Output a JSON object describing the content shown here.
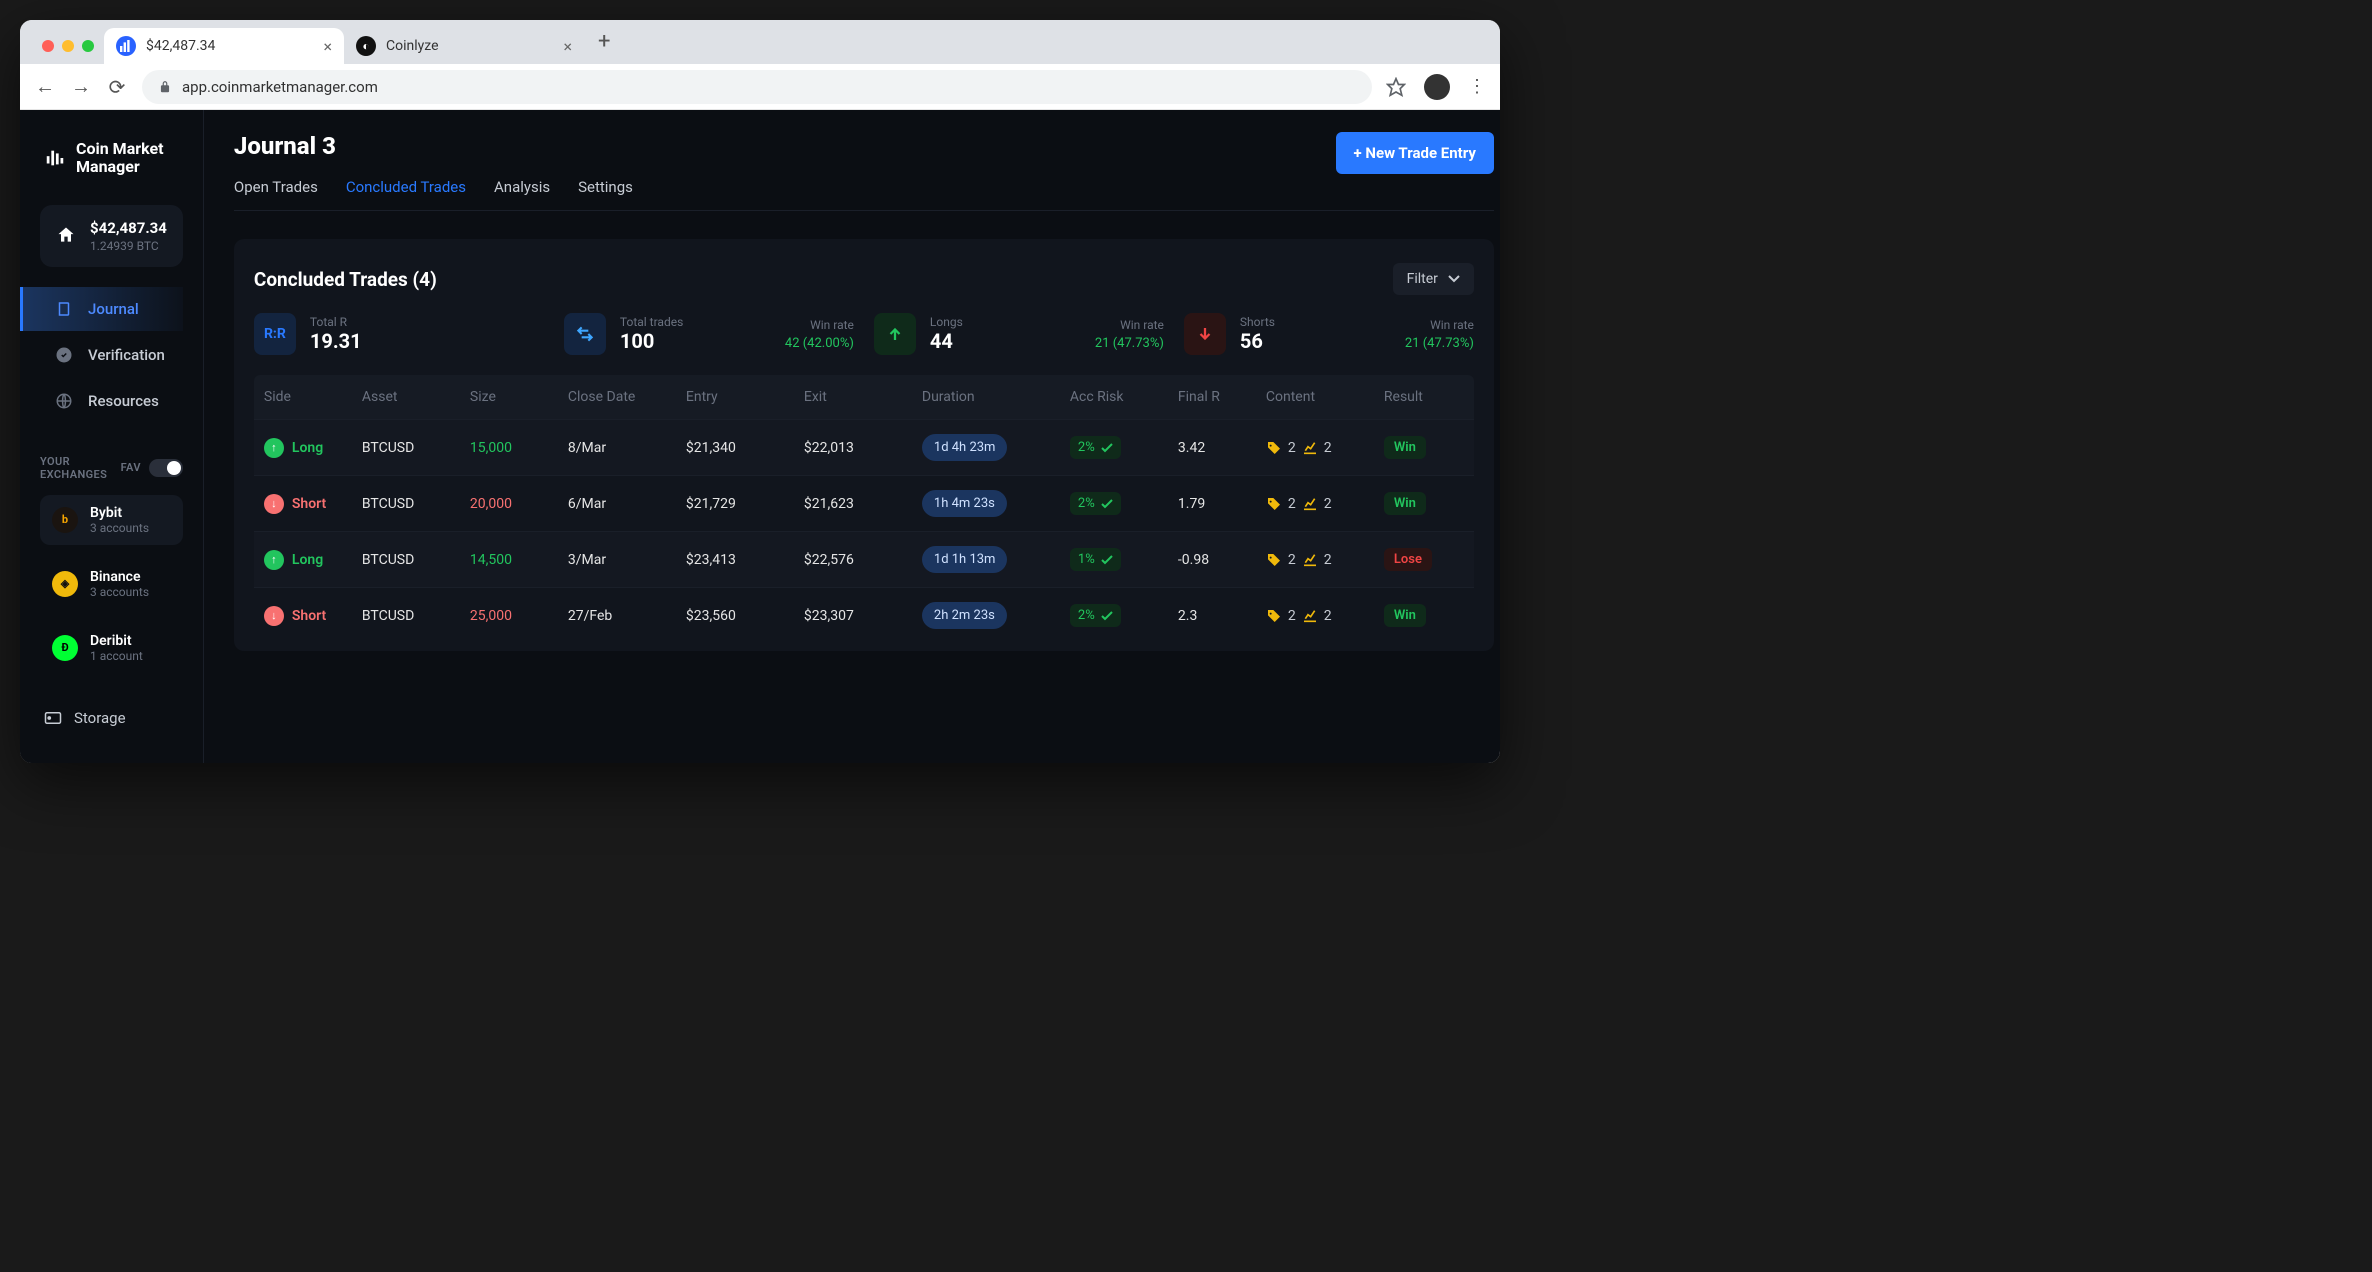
{
  "browser": {
    "tabs": [
      {
        "label": "$42,487.34",
        "active": true
      },
      {
        "label": "Coinlyze",
        "active": false
      }
    ],
    "url": "app.coinmarketmanager.com"
  },
  "sidebar": {
    "brand_line1": "Coin Market",
    "brand_line2": "Manager",
    "balance_usd": "$42,487.34",
    "balance_btc": "1.24939 BTC",
    "nav": {
      "journal": "Journal",
      "verification": "Verification",
      "resources": "Resources"
    },
    "exchanges_heading": "YOUR EXCHANGES",
    "fav_label": "FAV",
    "exchanges": [
      {
        "name": "Bybit",
        "sub": "3 accounts"
      },
      {
        "name": "Binance",
        "sub": "3 accounts"
      },
      {
        "name": "Deribit",
        "sub": "1 account"
      }
    ],
    "storage": "Storage"
  },
  "main": {
    "title": "Journal 3",
    "new_trade_label": "+ New Trade Entry",
    "tabs": {
      "open": "Open Trades",
      "concluded": "Concluded Trades",
      "analysis": "Analysis",
      "settings": "Settings"
    },
    "panel_title": "Concluded Trades (4)",
    "filter_label": "Filter",
    "stats": {
      "total_r": {
        "label": "Total R",
        "value": "19.31"
      },
      "total_trades": {
        "label": "Total trades",
        "value": "100",
        "wr_label": "Win rate",
        "wr_value": "42 (42.00%)"
      },
      "longs": {
        "label": "Longs",
        "value": "44",
        "wr_label": "Win rate",
        "wr_value": "21 (47.73%)"
      },
      "shorts": {
        "label": "Shorts",
        "value": "56",
        "wr_label": "Win rate",
        "wr_value": "21 (47.73%)"
      }
    },
    "columns": {
      "side": "Side",
      "asset": "Asset",
      "size": "Size",
      "close": "Close Date",
      "entry": "Entry",
      "exit": "Exit",
      "duration": "Duration",
      "risk": "Acc Risk",
      "finalr": "Final R",
      "content": "Content",
      "result": "Result"
    },
    "rows": [
      {
        "side": "Long",
        "asset": "BTCUSD",
        "size": "15,000",
        "close": "8/Mar",
        "entry": "$21,340",
        "exit": "$22,013",
        "duration": "1d 4h 23m",
        "risk": "2%",
        "finalr": "3.42",
        "c1": "2",
        "c2": "2",
        "result": "Win"
      },
      {
        "side": "Short",
        "asset": "BTCUSD",
        "size": "20,000",
        "close": "6/Mar",
        "entry": "$21,729",
        "exit": "$21,623",
        "duration": "1h 4m 23s",
        "risk": "2%",
        "finalr": "1.79",
        "c1": "2",
        "c2": "2",
        "result": "Win"
      },
      {
        "side": "Long",
        "asset": "BTCUSD",
        "size": "14,500",
        "close": "3/Mar",
        "entry": "$23,413",
        "exit": "$22,576",
        "duration": "1d 1h 13m",
        "risk": "1%",
        "finalr": "-0.98",
        "c1": "2",
        "c2": "2",
        "result": "Lose"
      },
      {
        "side": "Short",
        "asset": "BTCUSD",
        "size": "25,000",
        "close": "27/Feb",
        "entry": "$23,560",
        "exit": "$23,307",
        "duration": "2h 2m 23s",
        "risk": "2%",
        "finalr": "2.3",
        "c1": "2",
        "c2": "2",
        "result": "Win"
      }
    ]
  }
}
